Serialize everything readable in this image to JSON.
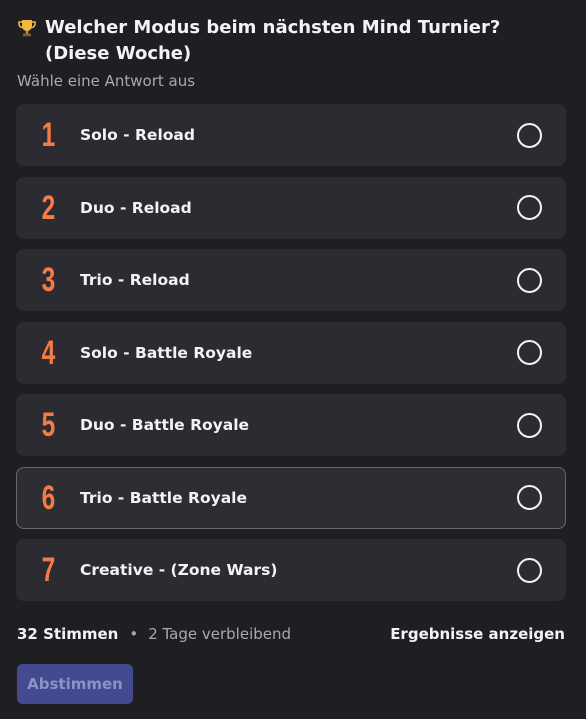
{
  "poll": {
    "question": "Welcher Modus beim nächsten Mind Turnier? (Diese Woche)",
    "question_icon": "trophy-icon",
    "subtitle": "Wähle eine Antwort aus",
    "answers": [
      {
        "number": "1",
        "label": "Solo - Reload"
      },
      {
        "number": "2",
        "label": "Duo - Reload"
      },
      {
        "number": "3",
        "label": "Trio - Reload"
      },
      {
        "number": "4",
        "label": "Solo - Battle Royale"
      },
      {
        "number": "5",
        "label": "Duo - Battle Royale"
      },
      {
        "number": "6",
        "label": "Trio - Battle Royale"
      },
      {
        "number": "7",
        "label": "Creative - (Zone Wars)"
      }
    ],
    "hovered_answer": "6",
    "votes": "32 Stimmen",
    "separator": "•",
    "time_remaining": "2 Tage verbleibend",
    "show_results": "Ergebnisse anzeigen",
    "vote_button": "Abstimmen"
  },
  "colors": {
    "background": "#1f1f23",
    "answer_background": "#2b2b31",
    "number_accent": "#f47b43",
    "button_disabled": "#444a8f"
  }
}
